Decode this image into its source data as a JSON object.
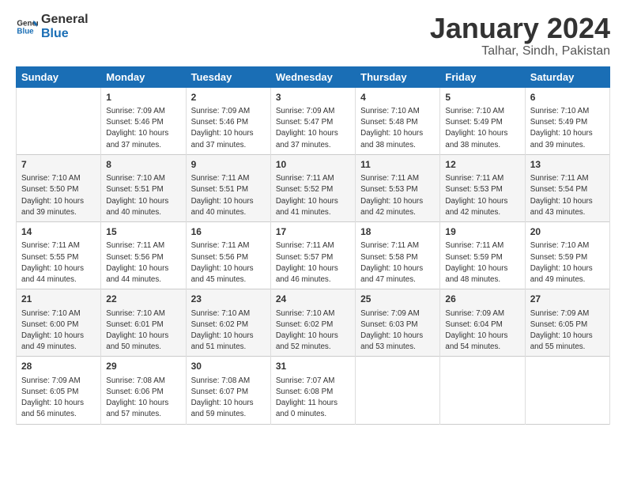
{
  "logo": {
    "line1": "General",
    "line2": "Blue"
  },
  "title": "January 2024",
  "location": "Talhar, Sindh, Pakistan",
  "weekdays": [
    "Sunday",
    "Monday",
    "Tuesday",
    "Wednesday",
    "Thursday",
    "Friday",
    "Saturday"
  ],
  "weeks": [
    [
      {
        "day": "",
        "info": ""
      },
      {
        "day": "1",
        "info": "Sunrise: 7:09 AM\nSunset: 5:46 PM\nDaylight: 10 hours\nand 37 minutes."
      },
      {
        "day": "2",
        "info": "Sunrise: 7:09 AM\nSunset: 5:46 PM\nDaylight: 10 hours\nand 37 minutes."
      },
      {
        "day": "3",
        "info": "Sunrise: 7:09 AM\nSunset: 5:47 PM\nDaylight: 10 hours\nand 37 minutes."
      },
      {
        "day": "4",
        "info": "Sunrise: 7:10 AM\nSunset: 5:48 PM\nDaylight: 10 hours\nand 38 minutes."
      },
      {
        "day": "5",
        "info": "Sunrise: 7:10 AM\nSunset: 5:49 PM\nDaylight: 10 hours\nand 38 minutes."
      },
      {
        "day": "6",
        "info": "Sunrise: 7:10 AM\nSunset: 5:49 PM\nDaylight: 10 hours\nand 39 minutes."
      }
    ],
    [
      {
        "day": "7",
        "info": "Sunrise: 7:10 AM\nSunset: 5:50 PM\nDaylight: 10 hours\nand 39 minutes."
      },
      {
        "day": "8",
        "info": "Sunrise: 7:10 AM\nSunset: 5:51 PM\nDaylight: 10 hours\nand 40 minutes."
      },
      {
        "day": "9",
        "info": "Sunrise: 7:11 AM\nSunset: 5:51 PM\nDaylight: 10 hours\nand 40 minutes."
      },
      {
        "day": "10",
        "info": "Sunrise: 7:11 AM\nSunset: 5:52 PM\nDaylight: 10 hours\nand 41 minutes."
      },
      {
        "day": "11",
        "info": "Sunrise: 7:11 AM\nSunset: 5:53 PM\nDaylight: 10 hours\nand 42 minutes."
      },
      {
        "day": "12",
        "info": "Sunrise: 7:11 AM\nSunset: 5:53 PM\nDaylight: 10 hours\nand 42 minutes."
      },
      {
        "day": "13",
        "info": "Sunrise: 7:11 AM\nSunset: 5:54 PM\nDaylight: 10 hours\nand 43 minutes."
      }
    ],
    [
      {
        "day": "14",
        "info": "Sunrise: 7:11 AM\nSunset: 5:55 PM\nDaylight: 10 hours\nand 44 minutes."
      },
      {
        "day": "15",
        "info": "Sunrise: 7:11 AM\nSunset: 5:56 PM\nDaylight: 10 hours\nand 44 minutes."
      },
      {
        "day": "16",
        "info": "Sunrise: 7:11 AM\nSunset: 5:56 PM\nDaylight: 10 hours\nand 45 minutes."
      },
      {
        "day": "17",
        "info": "Sunrise: 7:11 AM\nSunset: 5:57 PM\nDaylight: 10 hours\nand 46 minutes."
      },
      {
        "day": "18",
        "info": "Sunrise: 7:11 AM\nSunset: 5:58 PM\nDaylight: 10 hours\nand 47 minutes."
      },
      {
        "day": "19",
        "info": "Sunrise: 7:11 AM\nSunset: 5:59 PM\nDaylight: 10 hours\nand 48 minutes."
      },
      {
        "day": "20",
        "info": "Sunrise: 7:10 AM\nSunset: 5:59 PM\nDaylight: 10 hours\nand 49 minutes."
      }
    ],
    [
      {
        "day": "21",
        "info": "Sunrise: 7:10 AM\nSunset: 6:00 PM\nDaylight: 10 hours\nand 49 minutes."
      },
      {
        "day": "22",
        "info": "Sunrise: 7:10 AM\nSunset: 6:01 PM\nDaylight: 10 hours\nand 50 minutes."
      },
      {
        "day": "23",
        "info": "Sunrise: 7:10 AM\nSunset: 6:02 PM\nDaylight: 10 hours\nand 51 minutes."
      },
      {
        "day": "24",
        "info": "Sunrise: 7:10 AM\nSunset: 6:02 PM\nDaylight: 10 hours\nand 52 minutes."
      },
      {
        "day": "25",
        "info": "Sunrise: 7:09 AM\nSunset: 6:03 PM\nDaylight: 10 hours\nand 53 minutes."
      },
      {
        "day": "26",
        "info": "Sunrise: 7:09 AM\nSunset: 6:04 PM\nDaylight: 10 hours\nand 54 minutes."
      },
      {
        "day": "27",
        "info": "Sunrise: 7:09 AM\nSunset: 6:05 PM\nDaylight: 10 hours\nand 55 minutes."
      }
    ],
    [
      {
        "day": "28",
        "info": "Sunrise: 7:09 AM\nSunset: 6:05 PM\nDaylight: 10 hours\nand 56 minutes."
      },
      {
        "day": "29",
        "info": "Sunrise: 7:08 AM\nSunset: 6:06 PM\nDaylight: 10 hours\nand 57 minutes."
      },
      {
        "day": "30",
        "info": "Sunrise: 7:08 AM\nSunset: 6:07 PM\nDaylight: 10 hours\nand 59 minutes."
      },
      {
        "day": "31",
        "info": "Sunrise: 7:07 AM\nSunset: 6:08 PM\nDaylight: 11 hours\nand 0 minutes."
      },
      {
        "day": "",
        "info": ""
      },
      {
        "day": "",
        "info": ""
      },
      {
        "day": "",
        "info": ""
      }
    ]
  ]
}
